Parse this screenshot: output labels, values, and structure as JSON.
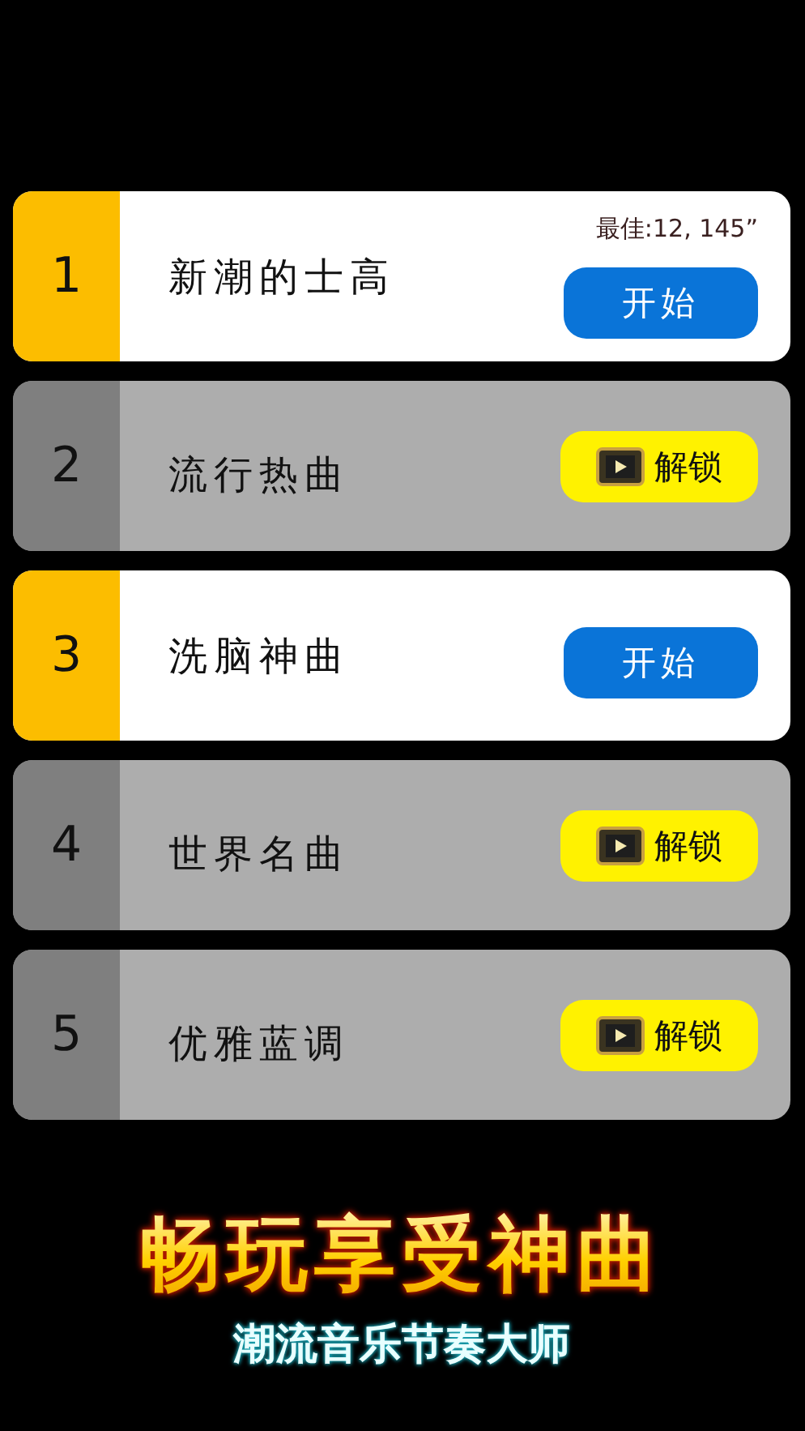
{
  "levels": [
    {
      "number": "1",
      "title": "新潮的士高",
      "locked": false,
      "best": "最佳:12, 145”",
      "button": "开始"
    },
    {
      "number": "2",
      "title": "流行热曲",
      "locked": true,
      "button": "解锁"
    },
    {
      "number": "3",
      "title": "洗脑神曲",
      "locked": false,
      "button": "开始"
    },
    {
      "number": "4",
      "title": "世界名曲",
      "locked": true,
      "button": "解锁"
    },
    {
      "number": "5",
      "title": "优雅蓝调",
      "locked": true,
      "button": "解锁"
    }
  ],
  "headline": "畅玩享受神曲",
  "subtitle": "潮流音乐节奏大师"
}
